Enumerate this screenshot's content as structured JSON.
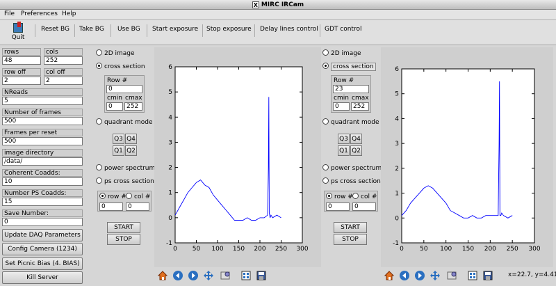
{
  "window": {
    "title": "MIRC IRCam"
  },
  "menu": [
    "File",
    "Preferences",
    "Help"
  ],
  "toolbar": {
    "quit": "Quit",
    "buttons": [
      "Reset BG",
      "Take BG",
      "Use BG",
      "Start exposure",
      "Stop exposure",
      "Delay lines control",
      "GDT control"
    ]
  },
  "params": {
    "rows_label": "rows",
    "rows": "48",
    "cols_label": "cols",
    "cols": "252",
    "rowoff_label": "row off",
    "rowoff": "2",
    "coloff_label": "col off",
    "coloff": "2",
    "nreads_label": "NReads",
    "nreads": "5",
    "frames_label": "Number of frames",
    "frames": "500",
    "fpr_label": "Frames per reset",
    "fpr": "500",
    "dir_label": "image directory",
    "dir": "/data/",
    "coadds_label": "Coherent Coadds:",
    "coadds": "10",
    "pscoadds_label": "Number PS Coadds:",
    "pscoadds": "15",
    "save_label": "Save Number:",
    "save": "0"
  },
  "actions": {
    "update": "Update DAQ Parameters",
    "config": "Config Camera (1234)",
    "picnic": "Set Picnic Bias (4. BIAS)",
    "kill": "Kill Server"
  },
  "panel1": {
    "image2d": "2D image",
    "cross": "cross section",
    "row_label": "Row #",
    "row": "0",
    "cmin_label": "cmin",
    "cmax_label": "cmax",
    "cmin": "0",
    "cmax": "252",
    "quadrant": "quadrant mode",
    "q3": "Q3",
    "q4": "Q4",
    "q1": "Q1",
    "q2": "Q2",
    "power": "power spectrum",
    "pscross": "ps cross section",
    "rowsel": "row #",
    "colsel": "col #",
    "rowval": "0",
    "colval": "0",
    "start": "START",
    "stop": "STOP"
  },
  "panel2": {
    "image2d": "2D image",
    "cross": "cross section",
    "row_label": "Row #",
    "row": "23",
    "cmin_label": "cmin",
    "cmax_label": "cmax",
    "cmin": "0",
    "cmax": "252",
    "quadrant": "quadrant mode",
    "q3": "Q3",
    "q4": "Q4",
    "q1": "Q1",
    "q2": "Q2",
    "power": "power spectrum",
    "pscross": "ps cross section",
    "rowsel": "row #",
    "colsel": "col #",
    "rowval": "0",
    "colval": "0",
    "start": "START",
    "stop": "STOP"
  },
  "nav_icons": [
    "home-icon",
    "back-icon",
    "forward-icon",
    "pan-icon",
    "zoom-icon",
    "subplots-icon",
    "save-icon"
  ],
  "coords": "x=22.7, y=4.41",
  "chart_data": [
    {
      "type": "line",
      "xlim": [
        0,
        300
      ],
      "ylim": [
        -1,
        6
      ],
      "xticks": [
        "0",
        "50",
        "100",
        "150",
        "200",
        "250",
        "300"
      ],
      "yticks": [
        "-1",
        "0",
        "1",
        "2",
        "3",
        "4",
        "5",
        "6"
      ],
      "color": "#0000ff",
      "x": [
        0,
        10,
        20,
        30,
        40,
        50,
        60,
        70,
        80,
        90,
        100,
        110,
        120,
        130,
        140,
        150,
        160,
        170,
        180,
        190,
        200,
        210,
        218,
        220,
        221,
        222,
        224,
        226,
        230,
        240,
        250
      ],
      "y": [
        0.1,
        0.4,
        0.7,
        1.0,
        1.2,
        1.4,
        1.5,
        1.3,
        1.2,
        0.9,
        0.7,
        0.5,
        0.3,
        0.1,
        -0.1,
        -0.1,
        -0.1,
        0.0,
        -0.1,
        -0.1,
        0.0,
        0.0,
        0.1,
        2.0,
        4.8,
        0.2,
        0.0,
        0.1,
        0.0,
        0.1,
        0.0
      ]
    },
    {
      "type": "line",
      "xlim": [
        0,
        300
      ],
      "ylim": [
        -1,
        6
      ],
      "xticks": [
        "0",
        "50",
        "100",
        "150",
        "200",
        "250",
        "300"
      ],
      "yticks": [
        "-1",
        "0",
        "1",
        "2",
        "3",
        "4",
        "5",
        "6"
      ],
      "color": "#0000ff",
      "x": [
        0,
        10,
        20,
        30,
        40,
        50,
        60,
        70,
        80,
        90,
        100,
        110,
        120,
        130,
        140,
        150,
        160,
        170,
        180,
        190,
        200,
        210,
        218,
        220,
        221,
        222,
        224,
        226,
        230,
        240,
        250
      ],
      "y": [
        0.1,
        0.3,
        0.6,
        0.8,
        1.0,
        1.2,
        1.3,
        1.2,
        1.0,
        0.8,
        0.6,
        0.3,
        0.2,
        0.1,
        0.0,
        0.0,
        0.1,
        0.0,
        0.0,
        0.1,
        0.1,
        0.1,
        0.1,
        3.0,
        5.5,
        0.1,
        0.1,
        0.2,
        0.1,
        0.0,
        0.1
      ]
    }
  ]
}
